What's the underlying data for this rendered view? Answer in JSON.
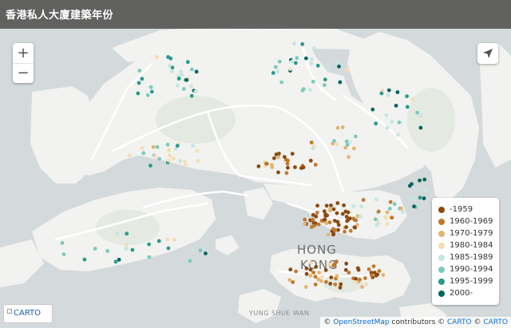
{
  "header": {
    "title": "香港私人大廈建築年份"
  },
  "zoom": {
    "in_label": "+",
    "out_label": "−"
  },
  "controls": {
    "locate_icon": "navigation-arrow-icon"
  },
  "map_labels": {
    "hong_kong_line1": "HONG",
    "hong_kong_line2": "KONG",
    "yung_shue_wan": "YUNG SHUE WAN"
  },
  "legend": {
    "items": [
      {
        "label": "-1959",
        "color": "#8c4a10"
      },
      {
        "label": "1960-1969",
        "color": "#c07a2e"
      },
      {
        "label": "1970-1979",
        "color": "#e3b470"
      },
      {
        "label": "1980-1984",
        "color": "#f3dfb2"
      },
      {
        "label": "1985-1989",
        "color": "#c6e6e0"
      },
      {
        "label": "1990-1994",
        "color": "#7ccabd"
      },
      {
        "label": "1995-1999",
        "color": "#2a9a8c"
      },
      {
        "label": "2000-",
        "color": "#01665e"
      }
    ]
  },
  "logo": {
    "alt": "CARTO"
  },
  "attribution": {
    "prefix": "©",
    "osm": "OpenStreetMap",
    "contributors": "contributors ©",
    "carto1": "CARTO",
    "sep": "©",
    "carto2": "CARTO"
  }
}
